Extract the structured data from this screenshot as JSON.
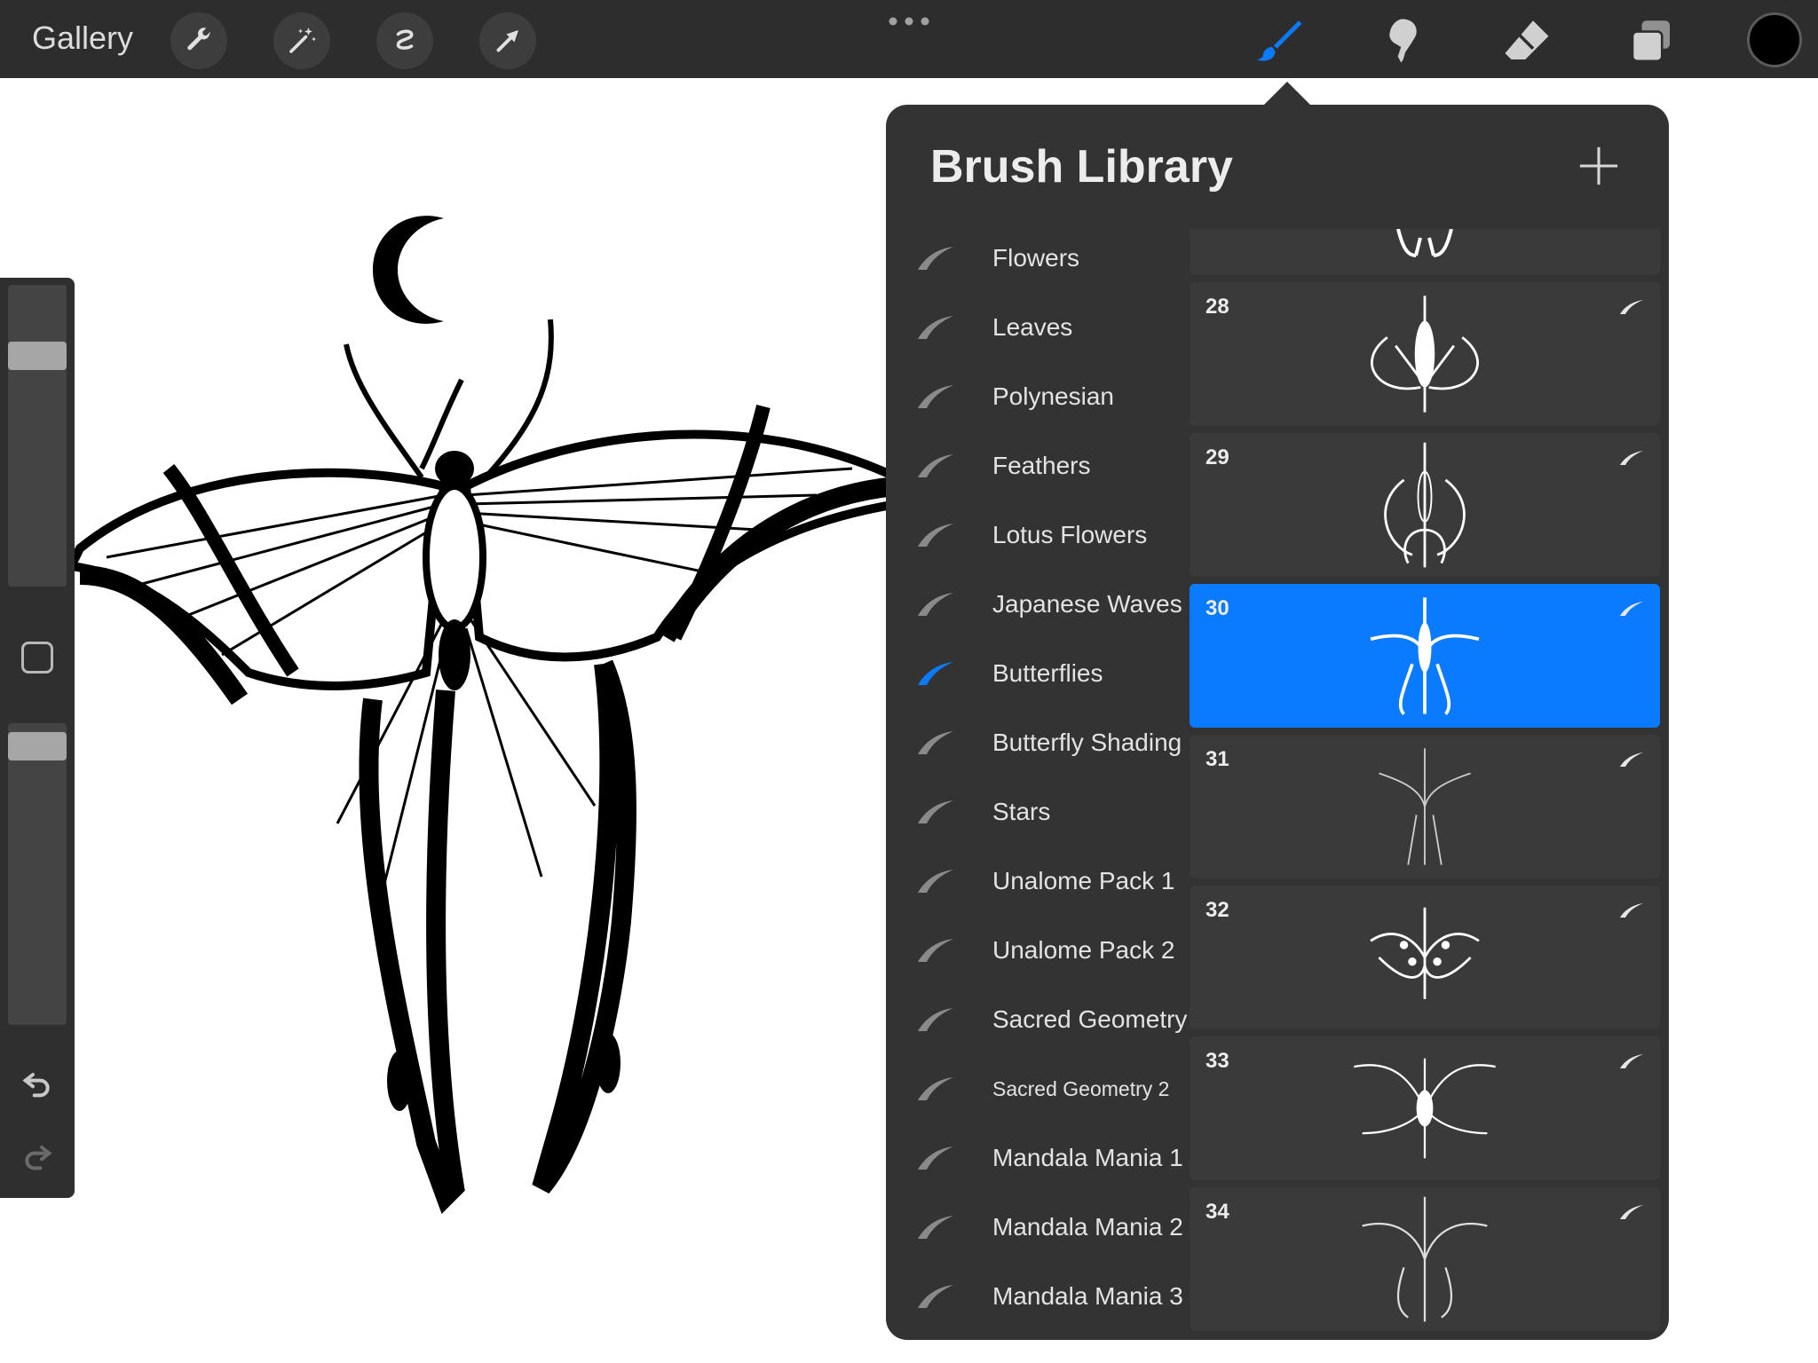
{
  "topbar": {
    "gallery_label": "Gallery",
    "tools": [
      "wrench-icon",
      "magic-wand-icon",
      "selection-icon",
      "transform-arrow-icon"
    ],
    "right_tools": [
      "brush-icon",
      "smudge-icon",
      "eraser-icon",
      "layers-icon"
    ],
    "current_color": "#000000",
    "accent_color": "#0a7bff"
  },
  "panel": {
    "title": "Brush Library",
    "categories": [
      {
        "label": "Flowers",
        "selected": false
      },
      {
        "label": "Leaves",
        "selected": false
      },
      {
        "label": "Polynesian",
        "selected": false
      },
      {
        "label": "Feathers",
        "selected": false
      },
      {
        "label": "Lotus Flowers",
        "selected": false
      },
      {
        "label": "Japanese Waves",
        "selected": false
      },
      {
        "label": "Butterflies",
        "selected": true
      },
      {
        "label": "Butterfly Shading",
        "selected": false
      },
      {
        "label": "Stars",
        "selected": false
      },
      {
        "label": "Unalome Pack 1",
        "selected": false
      },
      {
        "label": "Unalome Pack 2",
        "selected": false
      },
      {
        "label": "Sacred Geometry",
        "selected": false
      },
      {
        "label": "Sacred Geometry 2",
        "selected": false
      },
      {
        "label": "Mandala Mania 1",
        "selected": false
      },
      {
        "label": "Mandala Mania 2",
        "selected": false
      },
      {
        "label": "Mandala Mania 3",
        "selected": false
      }
    ],
    "brushes": [
      {
        "number": "28",
        "selected": false
      },
      {
        "number": "29",
        "selected": false
      },
      {
        "number": "30",
        "selected": true
      },
      {
        "number": "31",
        "selected": false
      },
      {
        "number": "32",
        "selected": false
      },
      {
        "number": "33",
        "selected": false
      },
      {
        "number": "34",
        "selected": false
      }
    ]
  }
}
